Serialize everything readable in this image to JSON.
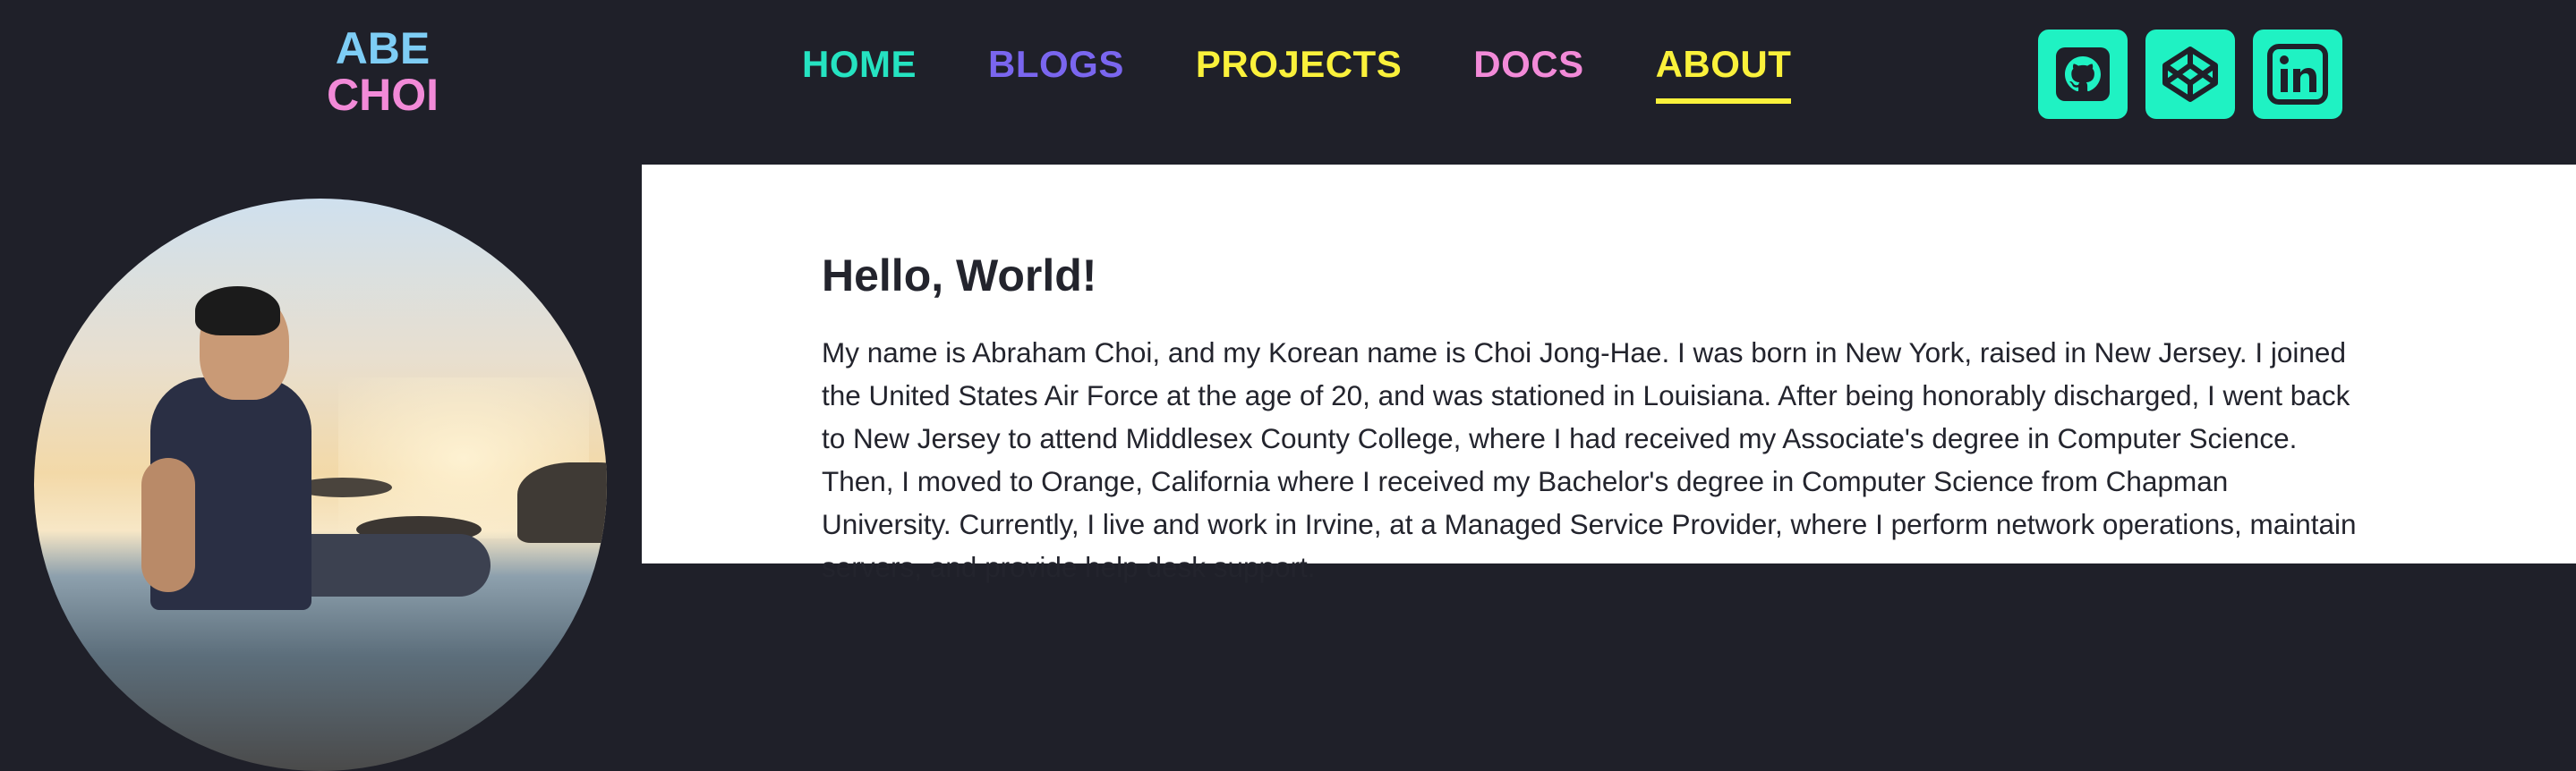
{
  "logo": {
    "line1": "ABE",
    "line2": "CHOI"
  },
  "nav": {
    "items": [
      {
        "label": "HOME",
        "color": "#25e3c1"
      },
      {
        "label": "BLOGS",
        "color": "#7a66ef"
      },
      {
        "label": "PROJECTS",
        "color": "#faf13b"
      },
      {
        "label": "DOCS",
        "color": "#f28ad8"
      },
      {
        "label": "ABOUT",
        "color": "#faf13b",
        "active": true
      }
    ]
  },
  "social": [
    "github-icon",
    "codepen-icon",
    "linkedin-icon"
  ],
  "colors": {
    "background": "#1f2029",
    "accent": "#1ff2c3"
  },
  "about": {
    "heading": "Hello, World!",
    "body": "My name is Abraham Choi, and my Korean name is Choi Jong-Hae. I was born in New York, raised in New Jersey. I joined the United States Air Force at the age of 20, and was stationed in Louisiana. After being honorably discharged, I went back to New Jersey to attend Middlesex County College, where I had received my Associate's degree in Computer Science. Then, I moved to Orange, California where I received my Bachelor's degree in Computer Science from Chapman University. Currently, I live and work in Irvine, at a Managed Service Provider, where I perform network operations, maintain servers, and provide help desk support."
  }
}
